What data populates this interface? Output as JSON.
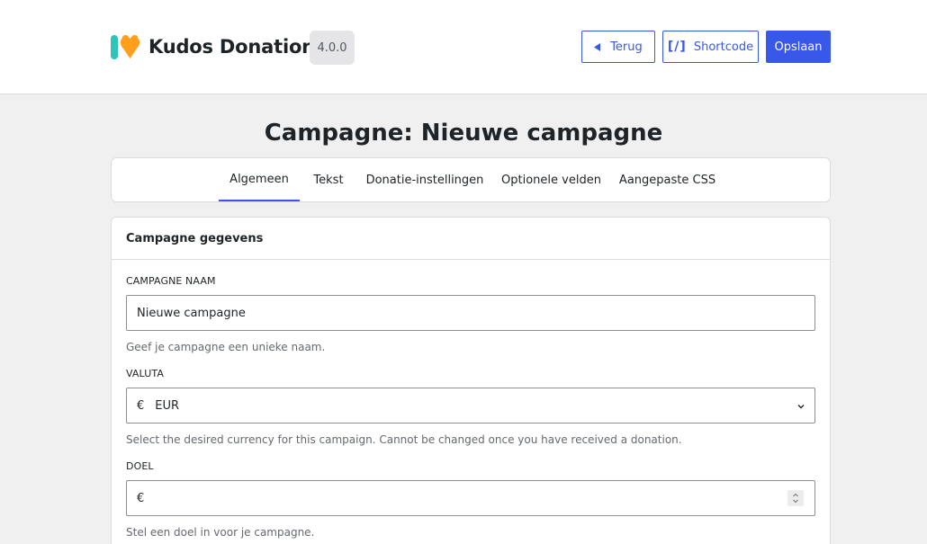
{
  "header": {
    "app_name": "Kudos Donations",
    "version": "4.0.0",
    "buttons": {
      "back": "Terug",
      "shortcode": "Shortcode",
      "shortcode_icon": "[/]",
      "save": "Opslaan"
    }
  },
  "page": {
    "title": "Campagne: Nieuwe campagne"
  },
  "tabs": [
    {
      "label": "Algemeen",
      "active": true
    },
    {
      "label": "Tekst",
      "active": false
    },
    {
      "label": "Donatie-instellingen",
      "active": false
    },
    {
      "label": "Optionele velden",
      "active": false
    },
    {
      "label": "Aangepaste CSS",
      "active": false
    }
  ],
  "section": {
    "title": "Campagne gegevens",
    "name_field": {
      "label": "CAMPAGNE NAAM",
      "value": "Nieuwe campagne",
      "help": "Geef je campagne een unieke naam."
    },
    "currency_field": {
      "label": "VALUTA",
      "symbol": "€",
      "value": "EUR",
      "help": "Select the desired currency for this campaign. Cannot be changed once you have received a donation."
    },
    "goal_field": {
      "label": "DOEL",
      "symbol": "€",
      "value": "",
      "help": "Stel een doel in voor je campagne."
    }
  },
  "colors": {
    "accent": "#3858e9",
    "logo_teal": "#2ec4b6",
    "logo_orange": "#ff9f1c"
  },
  "icons": [
    "kudos-logo-icon",
    "caret-left-icon",
    "shortcode-icon",
    "chevron-down-icon",
    "spinner-icon"
  ]
}
